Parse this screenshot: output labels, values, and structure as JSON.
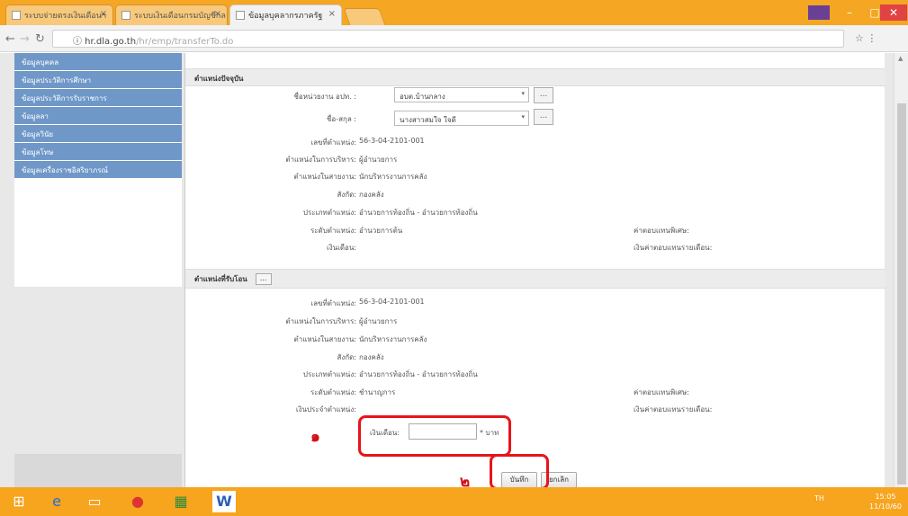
{
  "browser": {
    "tabs": [
      {
        "title": "ระบบจ่ายตรงเงินเดือนฯ"
      },
      {
        "title": "ระบบเงินเดือนกรมบัญชีกลาง"
      },
      {
        "title": "ข้อมูลบุคลากรภาครัฐ"
      }
    ],
    "url_host": "ⓘ hr.dla.go.th",
    "url_path": "/hr/emp/transferTo.do",
    "window_controls": {
      "minimize": "–",
      "maximize": "□",
      "close": "✕"
    }
  },
  "sidebar": {
    "items": [
      {
        "label": "ข้อมูลบุคคล"
      },
      {
        "label": "ข้อมูลประวัติการศึกษา"
      },
      {
        "label": "ข้อมูลประวัติการรับราชการ"
      },
      {
        "label": "ข้อมูลลา"
      },
      {
        "label": "ข้อมูลวินัย"
      },
      {
        "label": "ข้อมูลโทษ"
      },
      {
        "label": "ข้อมูลเครื่องราชอิสริยาภรณ์"
      }
    ]
  },
  "main": {
    "current_section": {
      "title": "ตำแหน่งปัจจุบัน",
      "fields": [
        {
          "label": "ชื่อหน่วยงาน อปท. :",
          "value": "อบต.บ้านกลาง",
          "type": "select"
        },
        {
          "label": "ชื่อ-สกุล :",
          "value": "นางสาวสมใจ ใจดี",
          "type": "select"
        },
        {
          "label": "เลขที่ตำแหน่ง:",
          "value": "56-3-04-2101-001"
        },
        {
          "label": "ตำแหน่งในการบริหาร:",
          "value": "ผู้อำนวยการ"
        },
        {
          "label": "ตำแหน่งในสายงาน:",
          "value": "นักบริหารงานการคลัง"
        },
        {
          "label": "สังกัด:",
          "value": "กองคลัง"
        },
        {
          "label": "ประเภทตำแหน่ง:",
          "value": "อำนวยการท้องถิ่น - อำนวยการท้องถิ่น"
        },
        {
          "label": "ระดับตำแหน่ง:",
          "value": "อำนวยการต้น"
        },
        {
          "label": "เงินเดือน:",
          "value": ""
        }
      ],
      "right_fields": [
        {
          "label": "ค่าตอบแทนพิเศษ:"
        },
        {
          "label": "เงินค่าตอบแทนรายเดือน:"
        }
      ]
    },
    "new_section": {
      "title": "ตำแหน่งที่รับโอน",
      "dots": "...",
      "fields": [
        {
          "label": "เลขที่ตำแหน่ง:",
          "value": "56-3-04-2101-001"
        },
        {
          "label": "ตำแหน่งในการบริหาร:",
          "value": "ผู้อำนวยการ"
        },
        {
          "label": "ตำแหน่งในสายงาน:",
          "value": "นักบริหารงานการคลัง"
        },
        {
          "label": "สังกัด:",
          "value": "กองคลัง"
        },
        {
          "label": "ประเภทตำแหน่ง:",
          "value": "อำนวยการท้องถิ่น - อำนวยการท้องถิ่น"
        },
        {
          "label": "ระดับตำแหน่ง:",
          "value": "ชำนาญการ"
        },
        {
          "label": "เงินประจำตำแหน่ง:",
          "value": ""
        }
      ],
      "right_fields": [
        {
          "label": "ค่าตอบแทนพิเศษ:"
        },
        {
          "label": "เงินค่าตอบแทนรายเดือน:"
        }
      ],
      "salary": {
        "label": "เงินเดือน:",
        "value": "",
        "unit": "* บาท"
      }
    },
    "buttons": {
      "save": "บันทึก",
      "cancel": "ยกเลิก"
    },
    "annotations": {
      "step1": "๑",
      "step2": "๒"
    }
  },
  "taskbar": {
    "clock_time": "15:05",
    "clock_date": "11/10/60",
    "tray_text": "TH"
  },
  "colors": {
    "title_bar": "#f5a623",
    "sidebar_item": "#6f98c8",
    "annotation": "#e8141a",
    "taskbar": "#f7a41e"
  }
}
